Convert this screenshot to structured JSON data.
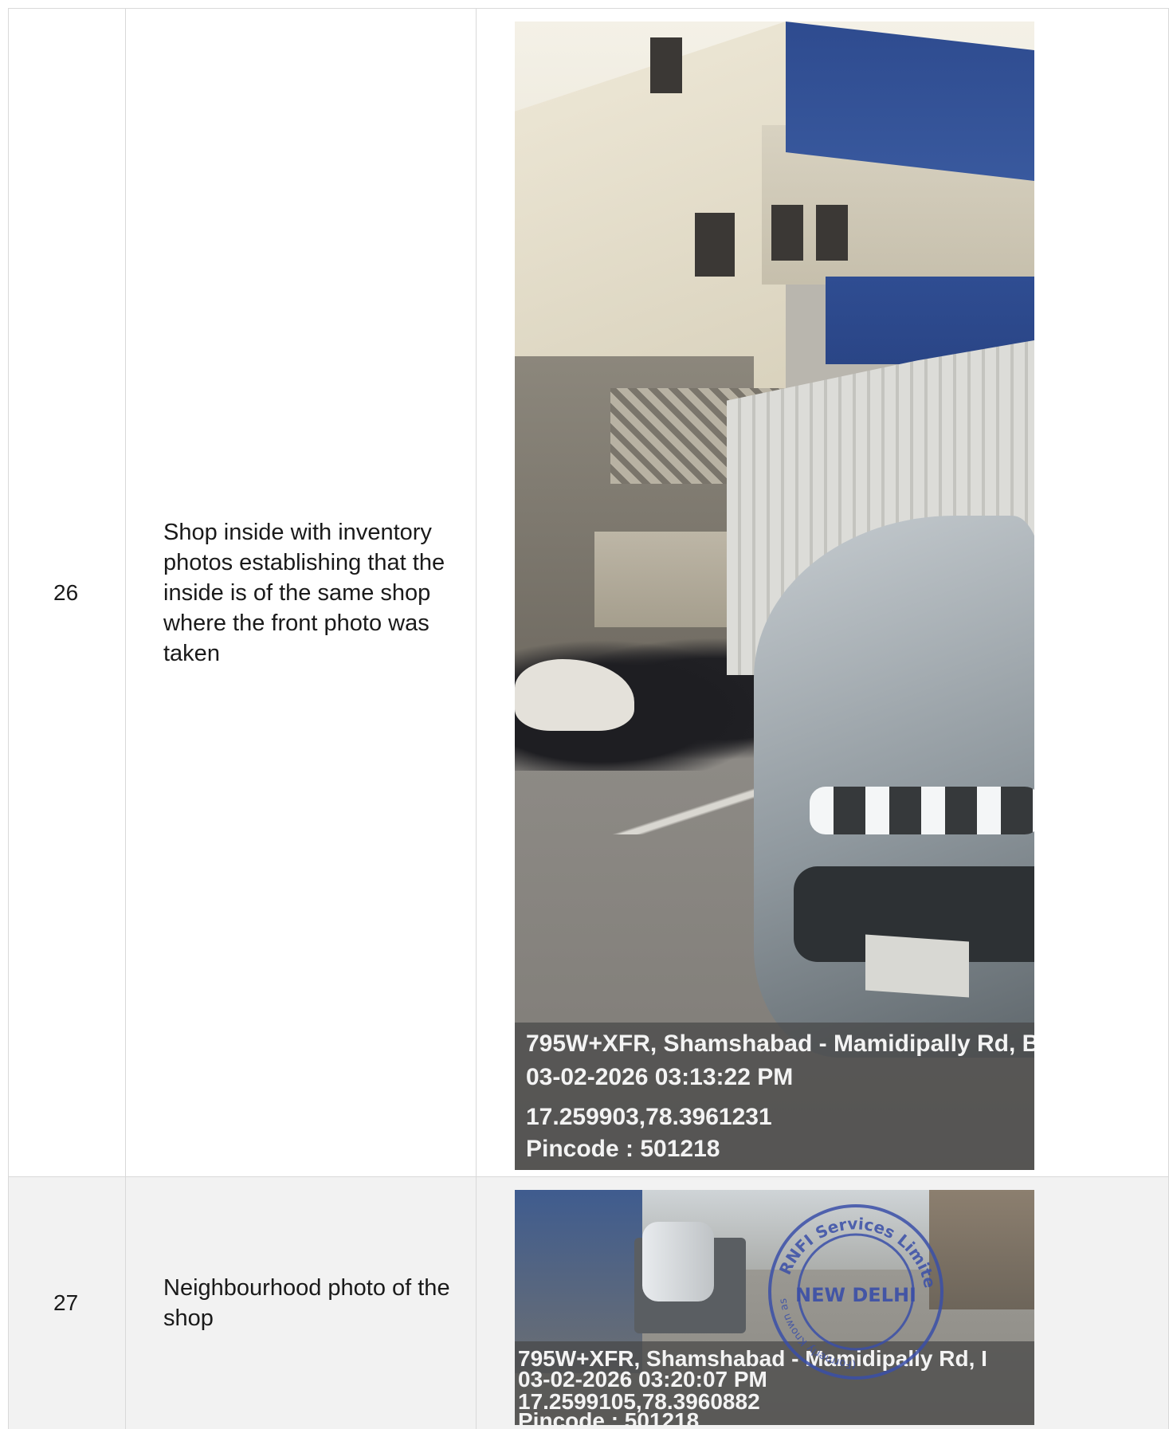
{
  "rows": [
    {
      "number": "26",
      "description": "Shop inside with inventory photos establishing that the inside is of the same shop where the front photo was taken",
      "photo": {
        "address": "795W+XFR, Shamshabad - Mamidipally Rd, B",
        "datetime": "03-02-2026 03:13:22 PM",
        "coordinates": "17.259903,78.3961231",
        "pincode": "Pincode : 501218"
      }
    },
    {
      "number": "27",
      "description": "Neighbourhood photo of the shop",
      "photo": {
        "address": "795W+XFR, Shamshabad - Mamidipally Rd, I",
        "datetime": "03-02-2026 03:20:07 PM",
        "coordinates": "17.2599105,78.3960882",
        "pincode": "Pincode : 501218",
        "stamp": {
          "top_text": "RNFI Services Limited",
          "center_text": "NEW DELHI",
          "left_text": "(Formerly Known as RNFI Services Pvt. Ltd.)",
          "color": "#3a4fa8"
        }
      }
    }
  ],
  "colors": {
    "border": "#d9d9d9",
    "row_alt_bg": "#f2f2f2",
    "text": "#1a1a1a"
  }
}
